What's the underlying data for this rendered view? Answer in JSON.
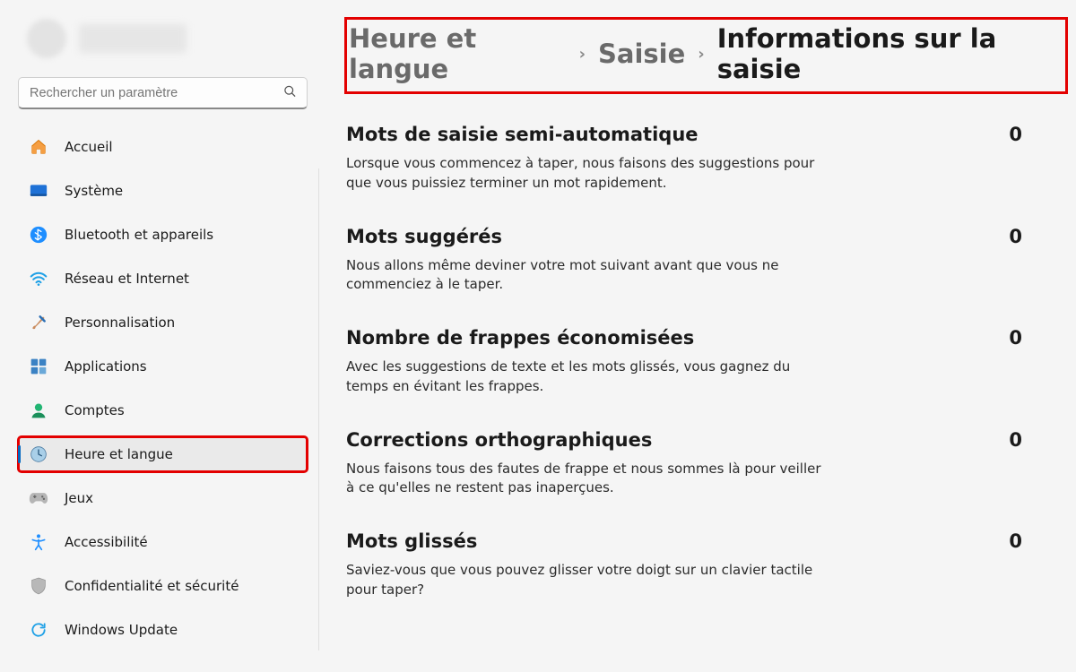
{
  "search": {
    "placeholder": "Rechercher un paramètre"
  },
  "sidebar": {
    "items": [
      {
        "label": "Accueil"
      },
      {
        "label": "Système"
      },
      {
        "label": "Bluetooth et appareils"
      },
      {
        "label": "Réseau et Internet"
      },
      {
        "label": "Personnalisation"
      },
      {
        "label": "Applications"
      },
      {
        "label": "Comptes"
      },
      {
        "label": "Heure et langue"
      },
      {
        "label": "Jeux"
      },
      {
        "label": "Accessibilité"
      },
      {
        "label": "Confidentialité et sécurité"
      },
      {
        "label": "Windows Update"
      }
    ]
  },
  "breadcrumb": {
    "a": "Heure et langue",
    "b": "Saisie",
    "c": "Informations sur la saisie"
  },
  "sections": [
    {
      "title": "Mots de saisie semi-automatique",
      "value": "0",
      "desc": "Lorsque vous commencez à taper, nous faisons des suggestions pour que vous puissiez terminer un mot rapidement."
    },
    {
      "title": "Mots suggérés",
      "value": "0",
      "desc": "Nous allons même deviner votre mot suivant avant que vous ne commenciez à le taper."
    },
    {
      "title": "Nombre de frappes économisées",
      "value": "0",
      "desc": "Avec les suggestions de texte et les mots glissés, vous gagnez du temps en évitant les frappes."
    },
    {
      "title": "Corrections orthographiques",
      "value": "0",
      "desc": "Nous faisons tous des fautes de frappe et nous sommes là pour veiller à ce qu'elles ne restent pas inaperçues."
    },
    {
      "title": "Mots glissés",
      "value": "0",
      "desc": "Saviez-vous que vous pouvez glisser votre doigt sur un clavier tactile pour taper?"
    }
  ]
}
